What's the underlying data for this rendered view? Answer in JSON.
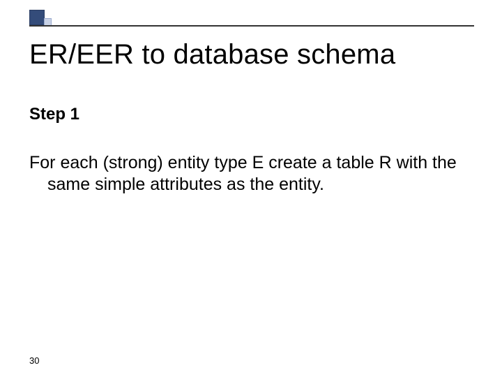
{
  "title": "ER/EER to database schema",
  "step_label": "Step 1",
  "body": "For each (strong) entity type E create a table R with the same simple attributes as the entity.",
  "page_number": "30"
}
